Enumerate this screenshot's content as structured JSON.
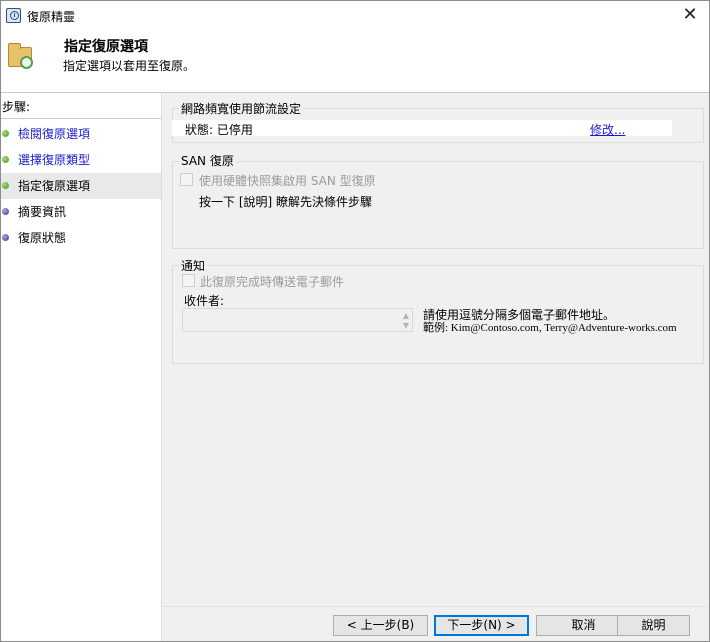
{
  "window": {
    "title": "復原精靈"
  },
  "header": {
    "title": "指定復原選項",
    "subtitle": "指定選項以套用至復原。"
  },
  "steps": {
    "heading": "步驟:",
    "items": [
      {
        "label": "檢閱復原選項",
        "state": "done",
        "link": true
      },
      {
        "label": "選擇復原類型",
        "state": "done",
        "link": true
      },
      {
        "label": "指定復原選項",
        "state": "current",
        "link": false
      },
      {
        "label": "摘要資訊",
        "state": "pending",
        "link": false
      },
      {
        "label": "復原狀態",
        "state": "pending",
        "link": false
      }
    ]
  },
  "bandwidth": {
    "title": "網路頻寬使用節流設定",
    "status": "狀態: 已停用",
    "modify": "修改..."
  },
  "san": {
    "title": "SAN 復原",
    "checkbox_label": "使用硬體快照集啟用 SAN 型復原",
    "help_text": "按一下 [說明] 瞭解先決條件步驟"
  },
  "notification": {
    "title": "通知",
    "checkbox_label": "此復原完成時傳送電子郵件",
    "recipients_label": "收件者:",
    "recipients_value": "",
    "hint_line1": "請使用逗號分隔多個電子郵件地址。",
    "hint_line2": "範例: Kim@Contoso.com, Terry@Adventure-works.com"
  },
  "buttons": {
    "back": "< 上一步(B)",
    "next": "下一步(N) >",
    "cancel": "取消",
    "help": "說明"
  },
  "colors": {
    "link": "#1a1acc",
    "accent": "#0078d7",
    "panel": "#f0f0f0",
    "done_dot": "#3f8f1f",
    "pending_dot": "#3b3593"
  }
}
